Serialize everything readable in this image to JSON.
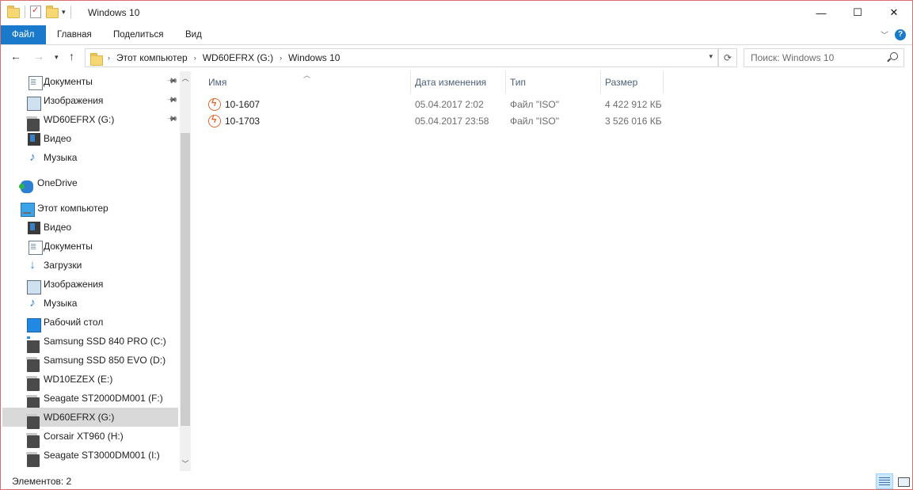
{
  "window": {
    "title": "Windows 10",
    "controls": {
      "minimize": "—",
      "maximize": "☐",
      "close": "✕"
    }
  },
  "ribbon": {
    "tabs": [
      "Файл",
      "Главная",
      "Поделиться",
      "Вид"
    ],
    "help": "?"
  },
  "address": {
    "crumbs": [
      "Этот компьютер",
      "WD60EFRX (G:)",
      "Windows 10"
    ],
    "search_placeholder": "Поиск: Windows 10"
  },
  "nav": {
    "items": [
      {
        "label": "Документы",
        "icon": "documents-icon",
        "pinned": true
      },
      {
        "label": "Изображения",
        "icon": "pictures-icon",
        "pinned": true
      },
      {
        "label": "WD60EFRX (G:)",
        "icon": "drive-icon",
        "pinned": true
      },
      {
        "label": "Видео",
        "icon": "video-icon"
      },
      {
        "label": "Музыка",
        "icon": "music-icon"
      },
      {
        "label": "OneDrive",
        "icon": "onedrive-icon"
      },
      {
        "label": "Этот компьютер",
        "icon": "computer-icon"
      },
      {
        "label": "Видео",
        "icon": "video-icon"
      },
      {
        "label": "Документы",
        "icon": "documents-icon"
      },
      {
        "label": "Загрузки",
        "icon": "downloads-icon"
      },
      {
        "label": "Изображения",
        "icon": "pictures-icon"
      },
      {
        "label": "Музыка",
        "icon": "music-icon"
      },
      {
        "label": "Рабочий стол",
        "icon": "desktop-icon"
      },
      {
        "label": "Samsung SSD 840 PRO (C:)",
        "icon": "system-drive-icon"
      },
      {
        "label": "Samsung SSD 850 EVO (D:)",
        "icon": "drive-icon"
      },
      {
        "label": "WD10EZEX (E:)",
        "icon": "drive-icon"
      },
      {
        "label": "Seagate ST2000DM001 (F:)",
        "icon": "drive-icon"
      },
      {
        "label": "WD60EFRX (G:)",
        "icon": "drive-icon",
        "selected": true
      },
      {
        "label": "Corsair XT960 (H:)",
        "icon": "drive-icon"
      },
      {
        "label": "Seagate ST3000DM001 (I:)",
        "icon": "drive-icon"
      }
    ]
  },
  "list": {
    "columns": [
      "Имя",
      "Дата изменения",
      "Тип",
      "Размер"
    ],
    "rows": [
      {
        "name": "10-1607",
        "date": "05.04.2017 2:02",
        "type": "Файл \"ISO\"",
        "size": "4 422 912 КБ"
      },
      {
        "name": "10-1703",
        "date": "05.04.2017 23:58",
        "type": "Файл \"ISO\"",
        "size": "3 526 016 КБ"
      }
    ]
  },
  "status": {
    "text": "Элементов: 2"
  }
}
